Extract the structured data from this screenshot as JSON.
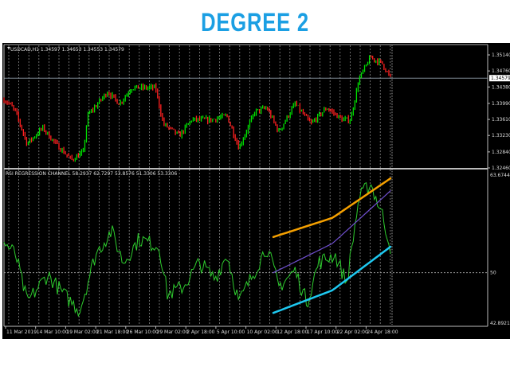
{
  "title": "DEGREE 2",
  "price_header": "USDCAD,H1  1.34597 1.34653 1.34553 1.34579",
  "rsi_header": "RSI REGRESSION CHANNEL 58.2937 62.7297 53.8576 51.3306 53.3306",
  "current_price_label": "1.34579",
  "colors": {
    "bull": "#00e000",
    "bear": "#ff2020",
    "orange": "#f5a000",
    "purple": "#7050d0",
    "cyan": "#1ec8f0",
    "rsi": "#2ecc2e",
    "title": "#1b9fe3"
  },
  "chart_data": [
    {
      "type": "bar",
      "name": "USDCAD H1 price",
      "yticks": [
        "1.35140",
        "1.34760",
        "1.34380",
        "1.33990",
        "1.33610",
        "1.33230",
        "1.32840",
        "1.32460"
      ],
      "ylim": [
        1.3246,
        1.3514
      ],
      "x_ticks": [
        "11 Mar 2019",
        "14 Mar 10:00",
        "19 Mar 02:00",
        "21 Mar 18:00",
        "26 Mar 10:00",
        "29 Mar 02:00",
        "2 Apr 18:00",
        "5 Apr 10:00",
        "10 Apr 02:00",
        "12 Apr 18:00",
        "17 Apr 10:00",
        "22 Apr 02:00",
        "24 Apr 18:00"
      ],
      "keypoints_x": [
        0,
        1.4,
        3,
        6,
        10,
        13.4,
        17.5,
        20.6,
        21.6,
        26.8,
        29.9,
        33,
        39.2,
        41.2,
        45.4,
        48.5,
        53.6,
        57.7,
        60.8,
        64.9,
        68,
        71.1,
        75.3,
        79.4,
        83.5,
        87.6,
        89.7,
        91.8,
        94.8,
        97.9,
        100
      ],
      "keypoints_y": [
        1.34076,
        1.33981,
        1.33791,
        1.33031,
        1.33411,
        1.33031,
        1.32651,
        1.32841,
        1.33696,
        1.34266,
        1.33981,
        1.34361,
        1.34361,
        1.33506,
        1.33221,
        1.33601,
        1.33601,
        1.33696,
        1.32936,
        1.33791,
        1.33886,
        1.33316,
        1.33981,
        1.33506,
        1.33886,
        1.33601,
        1.33601,
        1.34551,
        1.35083,
        1.34931,
        1.34589
      ]
    },
    {
      "type": "line",
      "name": "RSI regression channel",
      "yticks": [
        "63.6744",
        "50",
        "42.8921"
      ],
      "ylim": [
        42.8921,
        63.6744
      ],
      "keypoints_x": [
        0,
        3,
        6,
        11.3,
        15.5,
        19.6,
        23.7,
        27.8,
        30.9,
        35,
        40.2,
        42.3,
        46.4,
        50.5,
        54.6,
        57.7,
        60.8,
        64.9,
        68,
        71.1,
        75.3,
        78.4,
        81.4,
        85.6,
        88.7,
        91.8,
        94.8,
        97.9,
        100
      ],
      "rsi": [
        54.1,
        52.5,
        45.94,
        49.75,
        47.0,
        44.85,
        52.5,
        55.73,
        51.38,
        54.64,
        53.55,
        47.0,
        48.1,
        51.38,
        49.2,
        52.5,
        45.94,
        50.3,
        53.55,
        48.1,
        50.3,
        45.94,
        51.38,
        52.5,
        48.63,
        60.08,
        62.26,
        57.9,
        53.55
      ],
      "channel_x": [
        69.7,
        85,
        100
      ],
      "upper": [
        54.88,
        57.5,
        62.9
      ],
      "middle": [
        50.0,
        54.0,
        61.2
      ],
      "lower": [
        44.5,
        47.6,
        53.55
      ],
      "level": 50
    }
  ]
}
